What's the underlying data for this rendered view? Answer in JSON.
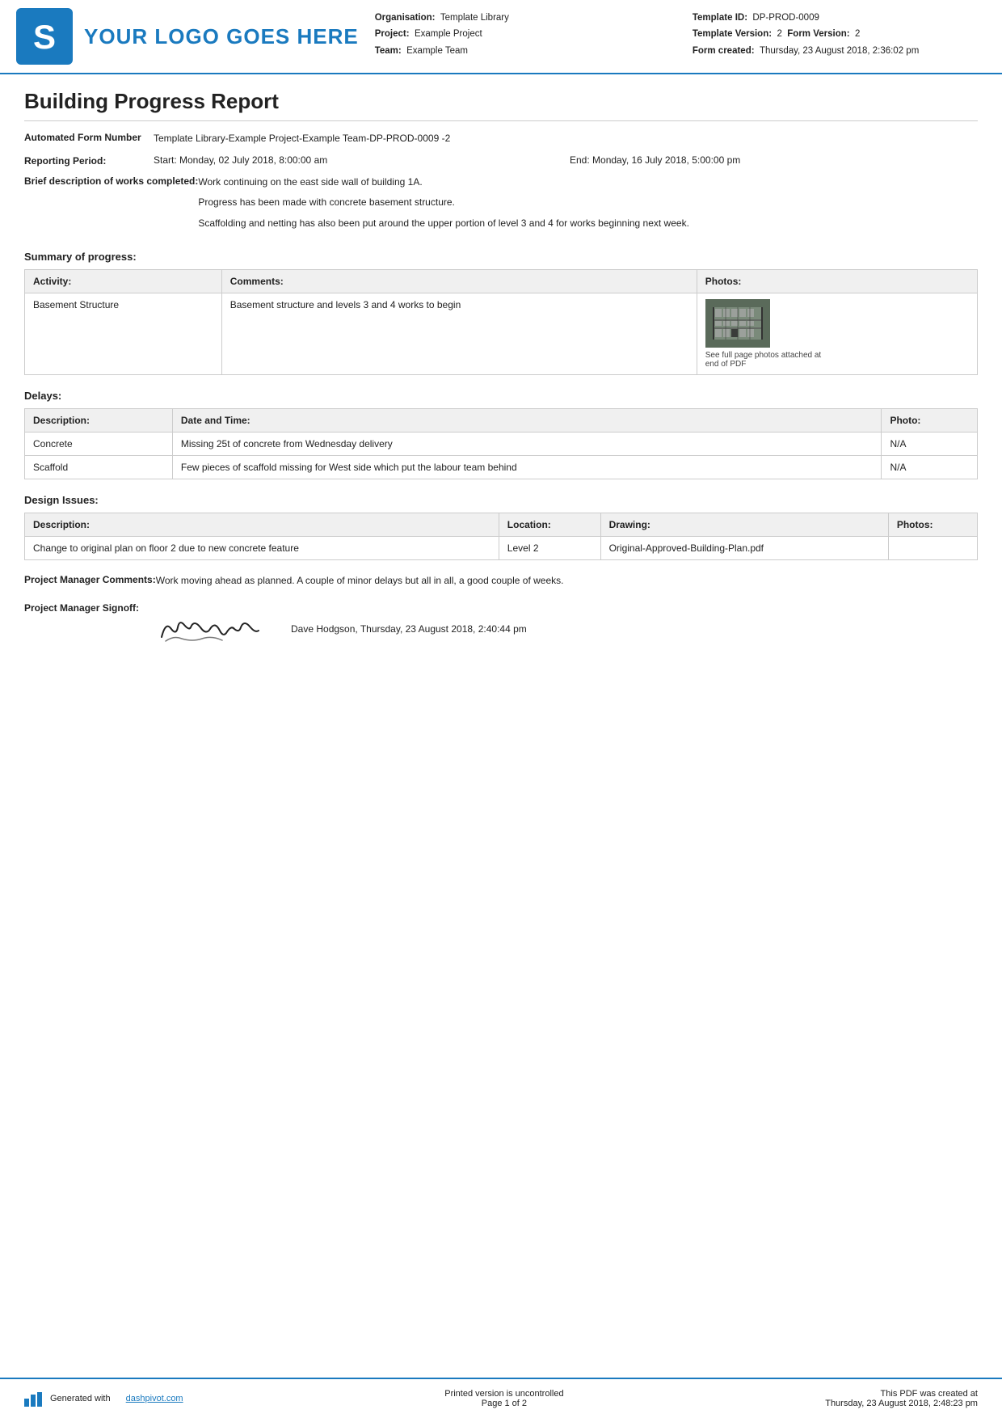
{
  "header": {
    "logo_text": "YOUR LOGO GOES HERE",
    "org_label": "Organisation:",
    "org_value": "Template Library",
    "project_label": "Project:",
    "project_value": "Example Project",
    "team_label": "Team:",
    "team_value": "Example Team",
    "template_id_label": "Template ID:",
    "template_id_value": "DP-PROD-0009",
    "template_version_label": "Template Version:",
    "template_version_value": "2",
    "form_version_label": "Form Version:",
    "form_version_value": "2",
    "form_created_label": "Form created:",
    "form_created_value": "Thursday, 23 August 2018, 2:36:02 pm"
  },
  "report": {
    "title": "Building Progress Report",
    "automated_form_label": "Automated Form Number",
    "automated_form_value": "Template Library-Example Project-Example Team-DP-PROD-0009   -2",
    "reporting_period_label": "Reporting Period:",
    "reporting_period_start": "Start: Monday, 02 July 2018, 8:00:00 am",
    "reporting_period_end": "End: Monday, 16 July 2018, 5:00:00 pm",
    "brief_desc_label": "Brief description of works completed:",
    "brief_desc_lines": [
      "Work continuing on the east side wall of building 1A.",
      "Progress has been made with concrete basement structure.",
      "Scaffolding and netting has also been put around the upper portion of level 3 and 4 for works beginning next week."
    ],
    "summary_section_title": "Summary of progress:",
    "summary_table": {
      "headers": [
        "Activity:",
        "Comments:",
        "Photos:"
      ],
      "rows": [
        {
          "activity": "Basement Structure",
          "comments": "Basement structure and levels 3 and 4 works to begin",
          "photo_caption": "See full page photos attached at end of PDF"
        }
      ]
    },
    "delays_section_title": "Delays:",
    "delays_table": {
      "headers": [
        "Description:",
        "Date and Time:",
        "Photo:"
      ],
      "rows": [
        {
          "description": "Concrete",
          "date_time": "Missing 25t of concrete from Wednesday delivery",
          "photo": "N/A"
        },
        {
          "description": "Scaffold",
          "date_time": "Few pieces of scaffold missing for West side which put the labour team behind",
          "photo": "N/A"
        }
      ]
    },
    "design_issues_section_title": "Design Issues:",
    "design_issues_table": {
      "headers": [
        "Description:",
        "Location:",
        "Drawing:",
        "Photos:"
      ],
      "rows": [
        {
          "description": "Change to original plan on floor 2 due to new concrete feature",
          "location": "Level 2",
          "drawing": "Original-Approved-Building-Plan.pdf",
          "photos": ""
        }
      ]
    },
    "pm_comments_label": "Project Manager Comments:",
    "pm_comments_value": "Work moving ahead as planned. A couple of minor delays but all in all, a good couple of weeks.",
    "pm_signoff_label": "Project Manager Signoff:",
    "pm_signoff_info": "Dave Hodgson, Thursday, 23 August 2018, 2:40:44 pm"
  },
  "footer": {
    "generated_text": "Generated with",
    "generated_link": "dashpivot.com",
    "printed_text": "Printed version is uncontrolled",
    "page_text": "Page 1 of 2",
    "pdf_created_text": "This PDF was created at",
    "pdf_created_date": "Thursday, 23 August 2018, 2:48:23 pm"
  }
}
